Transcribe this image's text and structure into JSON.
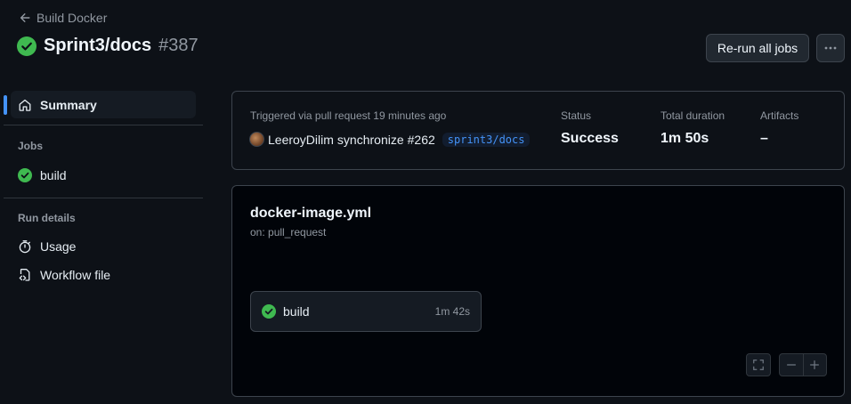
{
  "header": {
    "back_label": "Build Docker",
    "run_title": "Sprint3/docs",
    "run_number": "#387",
    "rerun_label": "Re-run all jobs"
  },
  "sidebar": {
    "summary_label": "Summary",
    "jobs_heading": "Jobs",
    "job_label": "build",
    "run_details_heading": "Run details",
    "usage_label": "Usage",
    "workflow_file_label": "Workflow file"
  },
  "summary": {
    "trigger_text": "Triggered via pull request 19 minutes ago",
    "actor": "LeeroyDilim",
    "event": "synchronize",
    "pr_number": "#262",
    "branch": "sprint3/docs",
    "status_label": "Status",
    "status_value": "Success",
    "duration_label": "Total duration",
    "duration_value": "1m 50s",
    "artifacts_label": "Artifacts",
    "artifacts_value": "–"
  },
  "workflow": {
    "file_name": "docker-image.yml",
    "trigger": "on: pull_request",
    "job_name": "build",
    "job_duration": "1m 42s"
  },
  "colors": {
    "success": "#3fb950",
    "accent": "#4493f8"
  }
}
